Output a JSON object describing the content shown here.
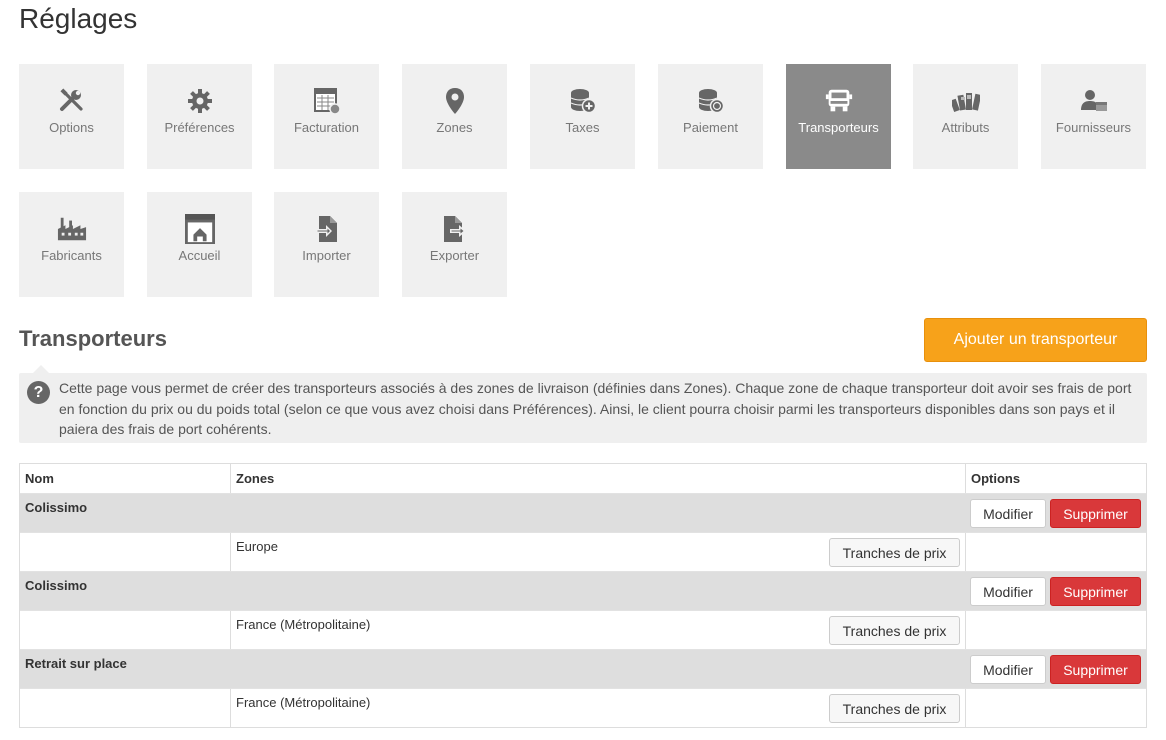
{
  "page": {
    "title": "Réglages"
  },
  "tiles": [
    {
      "label": "Options",
      "icon": "wrench-icon"
    },
    {
      "label": "Préférences",
      "icon": "gear-icon"
    },
    {
      "label": "Facturation",
      "icon": "invoice-icon"
    },
    {
      "label": "Zones",
      "icon": "map-pin-icon"
    },
    {
      "label": "Taxes",
      "icon": "coins-plus-icon"
    },
    {
      "label": "Paiement",
      "icon": "coins-icon"
    },
    {
      "label": "Transporteurs",
      "icon": "truck-icon",
      "active": true
    },
    {
      "label": "Attributs",
      "icon": "swatches-icon"
    },
    {
      "label": "Fournisseurs",
      "icon": "supplier-icon"
    },
    {
      "label": "Fabricants",
      "icon": "factory-icon"
    },
    {
      "label": "Accueil",
      "icon": "home-icon"
    },
    {
      "label": "Importer",
      "icon": "import-icon"
    },
    {
      "label": "Exporter",
      "icon": "export-icon"
    }
  ],
  "section": {
    "title": "Transporteurs",
    "add_button": "Ajouter un transporteur",
    "help_text": "Cette page vous permet de créer des transporteurs associés à des zones de livraison (définies dans Zones). Chaque zone de chaque transporteur doit avoir ses frais de port en fonction du prix ou du poids total (selon ce que vous avez choisi dans Préférences). Ainsi, le client pourra choisir parmi les transporteurs disponibles dans son pays et il paiera des frais de port cohérents."
  },
  "table": {
    "headers": {
      "name": "Nom",
      "zones": "Zones",
      "options": "Options"
    },
    "modify_label": "Modifier",
    "delete_label": "Supprimer",
    "ranges_label": "Tranches de prix",
    "carriers": [
      {
        "name": "Colissimo",
        "zone": "Europe"
      },
      {
        "name": "Colissimo",
        "zone": "France (Métropolitaine)"
      },
      {
        "name": "Retrait sur place",
        "zone": "France (Métropolitaine)"
      }
    ]
  },
  "colors": {
    "accent": "#f7a21a",
    "danger": "#d9383a",
    "active_tile": "#8a8a8a"
  }
}
